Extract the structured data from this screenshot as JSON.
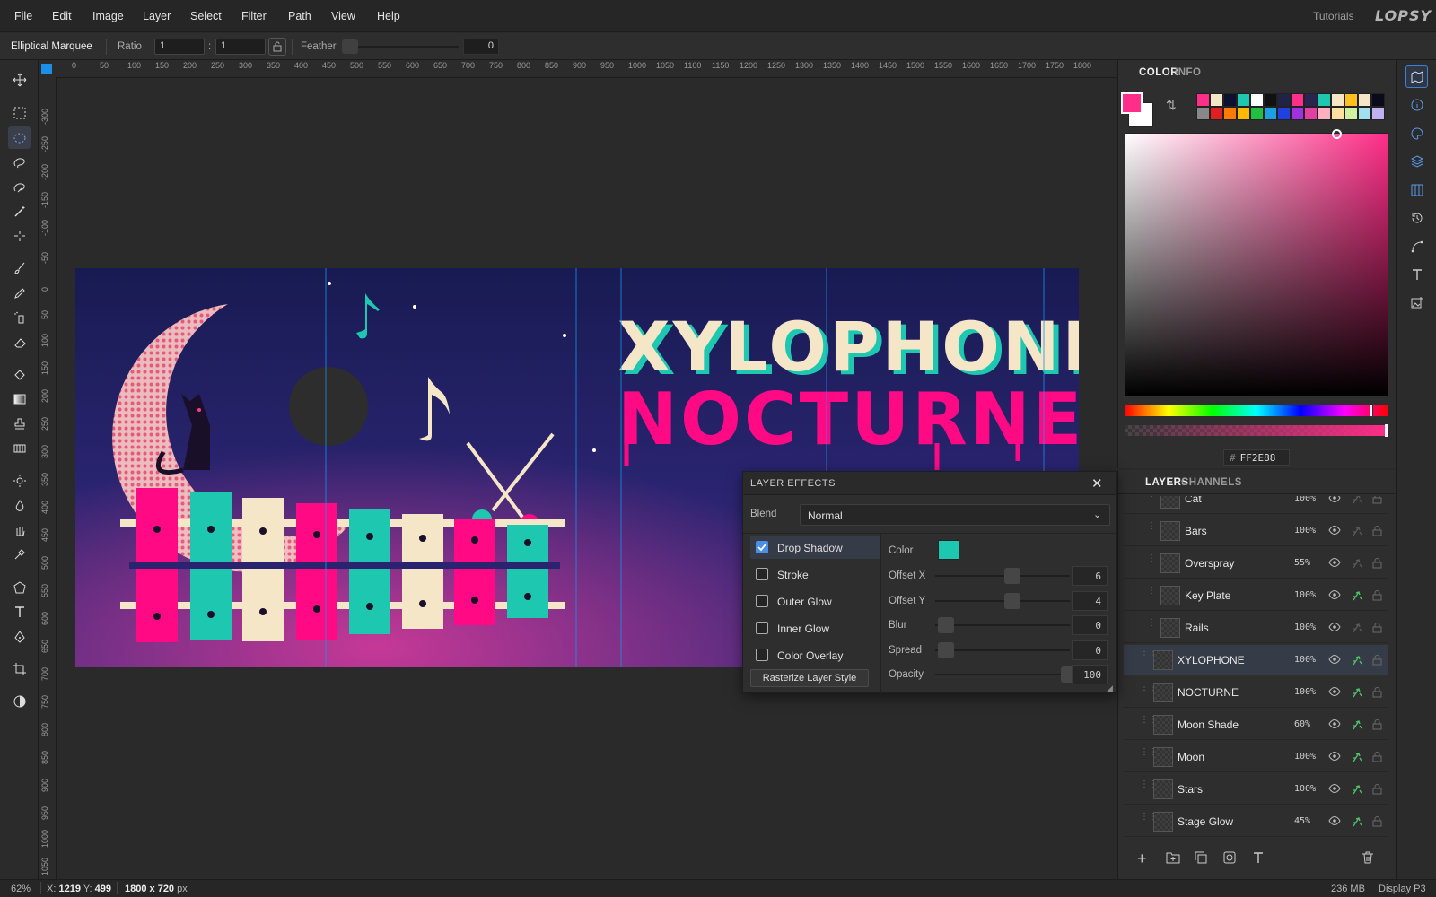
{
  "menu": [
    "File",
    "Edit",
    "Image",
    "Layer",
    "Select",
    "Filter",
    "Path",
    "View",
    "Help"
  ],
  "top_right": {
    "tutorials": "Tutorials",
    "logo": "LOPSY"
  },
  "options": {
    "tool_name": "Elliptical Marquee",
    "ratio_label": "Ratio",
    "ratio_w": "1",
    "ratio_sep": ":",
    "ratio_h": "1",
    "feather_label": "Feather",
    "feather_value": "0"
  },
  "ruler_top": [
    "0",
    "50",
    "100",
    "150",
    "200",
    "250",
    "300",
    "350",
    "400",
    "450",
    "500",
    "550",
    "600",
    "650",
    "700",
    "750",
    "800",
    "850",
    "900",
    "950",
    "1000",
    "1050",
    "1100",
    "1150",
    "1200",
    "1250",
    "1300",
    "1350",
    "1400",
    "1450",
    "1500",
    "1550",
    "1600",
    "1650",
    "1700",
    "1750",
    "1800"
  ],
  "ruler_left": [
    "-300",
    "-250",
    "-200",
    "-150",
    "-100",
    "-50",
    "0",
    "50",
    "100",
    "150",
    "200",
    "250",
    "300",
    "350",
    "400",
    "450",
    "500",
    "550",
    "600",
    "650",
    "700",
    "750",
    "800",
    "850",
    "900",
    "950",
    "1000",
    "1050"
  ],
  "artwork": {
    "line1": "XYLOPHONE",
    "line2": "NOCTURNE"
  },
  "color_panel": {
    "tabs": [
      "COLOR",
      "INFO"
    ],
    "hex_prefix": "#",
    "hex": "FF2E88",
    "foreground": "#FF2E88",
    "background": "#FFFFFF",
    "swatches_row1": [
      "#FF2E88",
      "#F5E6C8",
      "#0E1030",
      "#1EC8B0",
      "#FFFFFF",
      "#111111",
      "#222244",
      "#FF2E88",
      "#2A2450",
      "#1EC8B0",
      "#F5E6C8",
      "#FFC020",
      "#F5E6C8",
      "#0A0A1A"
    ],
    "swatches_row2": [
      "#888888",
      "#E02020",
      "#FF7A00",
      "#FFB800",
      "#22C040",
      "#1CA0E0",
      "#2040E0",
      "#A030E0",
      "#E040A0",
      "#FFB0C0",
      "#FFE0A0",
      "#D0F0A0",
      "#A0E0F0",
      "#C0B0F0"
    ]
  },
  "layers_panel": {
    "tabs": [
      "LAYERS",
      "CHANNELS"
    ],
    "layers": [
      {
        "name": "Cat",
        "opacity": "100%"
      },
      {
        "name": "Bars",
        "opacity": "100%"
      },
      {
        "name": "Overspray",
        "opacity": "55%"
      },
      {
        "name": "Key Plate",
        "opacity": "100%"
      },
      {
        "name": "Rails",
        "opacity": "100%"
      },
      {
        "name": "XYLOPHONE",
        "opacity": "100%"
      },
      {
        "name": "NOCTURNE",
        "opacity": "100%"
      },
      {
        "name": "Moon Shade",
        "opacity": "60%"
      },
      {
        "name": "Moon",
        "opacity": "100%"
      },
      {
        "name": "Stars",
        "opacity": "100%"
      },
      {
        "name": "Stage Glow",
        "opacity": "45%"
      }
    ]
  },
  "layer_effects": {
    "title": "LAYER EFFECTS",
    "blend_label": "Blend",
    "blend_value": "Normal",
    "effects": [
      "Drop Shadow",
      "Stroke",
      "Outer Glow",
      "Inner Glow",
      "Color Overlay"
    ],
    "rasterize": "Rasterize Layer Style",
    "color_label": "Color",
    "shadow_color": "#1EC8B0",
    "params": [
      {
        "name": "Offset X",
        "value": "6"
      },
      {
        "name": "Offset Y",
        "value": "4"
      },
      {
        "name": "Blur",
        "value": "0"
      },
      {
        "name": "Spread",
        "value": "0"
      },
      {
        "name": "Opacity",
        "value": "100"
      }
    ]
  },
  "status": {
    "zoom": "62%",
    "x_label": "X:",
    "x": "1219",
    "y_label": "Y:",
    "y": "499",
    "doc_size": "1800 x 720",
    "unit": "px",
    "memory": "236 MB",
    "profile": "Display P3"
  }
}
